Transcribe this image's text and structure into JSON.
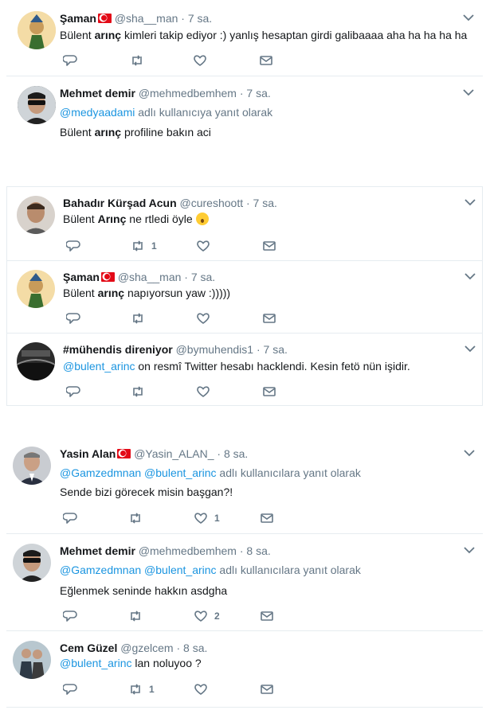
{
  "tweets": [
    {
      "name": "Şaman",
      "flag": true,
      "handle": "@sha__man",
      "time": "· 7 sa.",
      "reply_prefix": "",
      "reply_mentions": [],
      "reply_suffix": "",
      "text_parts": [
        {
          "t": "Bülent "
        },
        {
          "t": "arınç",
          "b": true
        },
        {
          "t": " kimleri takip ediyor :) yanlış hesaptan girdi galibaaaa aha ha ha ha ha"
        }
      ],
      "reply_count": "",
      "retweet_count": "",
      "like_count": "",
      "avatar": "cartoon-avatar"
    },
    {
      "name": "Mehmet demir",
      "flag": false,
      "handle": "@mehmedbemhem",
      "time": "· 7 sa.",
      "reply_mentions": [
        "@medyaadami"
      ],
      "reply_suffix": " adlı kullanıcıya yanıt olarak",
      "text_parts": [
        {
          "t": "Bülent "
        },
        {
          "t": "arınç",
          "b": true
        },
        {
          "t": " profiline bakın aci"
        }
      ],
      "reply_count": "",
      "retweet_count": "",
      "like_count": "",
      "avatar": "sunglasses-avatar"
    },
    {
      "name": "Bahadır Kürşad Acun",
      "flag": false,
      "handle": "@cureshoott",
      "time": "· 7 sa.",
      "reply_mentions": [],
      "reply_suffix": "",
      "text_parts": [
        {
          "t": "Bülent "
        },
        {
          "t": "Arınç",
          "b": true
        },
        {
          "t": " ne rtledi öyle "
        }
      ],
      "has_emoji": true,
      "reply_count": "",
      "retweet_count": "1",
      "like_count": "",
      "avatar": "man-avatar"
    },
    {
      "name": "Şaman",
      "flag": true,
      "handle": "@sha__man",
      "time": "· 7 sa.",
      "reply_mentions": [],
      "reply_suffix": "",
      "text_parts": [
        {
          "t": "Bülent "
        },
        {
          "t": "arınç",
          "b": true
        },
        {
          "t": " napıyorsun yaw :)))))"
        }
      ],
      "reply_count": "",
      "retweet_count": "",
      "like_count": "",
      "avatar": "cartoon-avatar"
    },
    {
      "name": "#mühendis direniyor",
      "flag": false,
      "handle": "@bymuhendis1",
      "time": "· 7 sa.",
      "reply_mentions": [],
      "reply_suffix": "",
      "text_parts": [
        {
          "t": "@bulent_arinc",
          "m": true
        },
        {
          "t": " on resmî Twitter hesabı hacklendi. Kesin fetö nün işidir."
        }
      ],
      "reply_count": "",
      "retweet_count": "",
      "like_count": "",
      "avatar": "crowd-avatar"
    },
    {
      "name": "Yasin Alan",
      "flag": true,
      "handle": "@Yasin_ALAN_",
      "time": "· 8 sa.",
      "reply_mentions": [
        "@Gamzedmnan",
        "@bulent_arinc"
      ],
      "reply_suffix": " adlı kullanıcılara yanıt olarak",
      "text_parts": [
        {
          "t": "Sende bizi görecek misin başgan?!"
        }
      ],
      "reply_count": "",
      "retweet_count": "",
      "like_count": "1",
      "avatar": "suit-avatar"
    },
    {
      "name": "Mehmet demir",
      "flag": false,
      "handle": "@mehmedbemhem",
      "time": "· 8 sa.",
      "reply_mentions": [
        "@Gamzedmnan",
        "@bulent_arinc"
      ],
      "reply_suffix": " adlı kullanıcılara yanıt olarak",
      "text_parts": [
        {
          "t": "Eğlenmek seninde hakkın asdgha"
        }
      ],
      "reply_count": "",
      "retweet_count": "",
      "like_count": "2",
      "avatar": "sunglasses-avatar"
    },
    {
      "name": "Cem Güzel",
      "flag": false,
      "handle": "@gzelcem",
      "time": "· 8 sa.",
      "reply_mentions": [],
      "reply_suffix": "",
      "text_parts": [
        {
          "t": "@bulent_arinc",
          "m": true
        },
        {
          "t": " lan noluyoo ?"
        }
      ],
      "reply_count": "",
      "retweet_count": "1",
      "like_count": "",
      "avatar": "couple-avatar"
    }
  ],
  "colors": {
    "text": "#14171a",
    "secondary": "#657786",
    "link": "#1b95e0",
    "border": "#e6ecf0",
    "flag": "#e30a17"
  }
}
